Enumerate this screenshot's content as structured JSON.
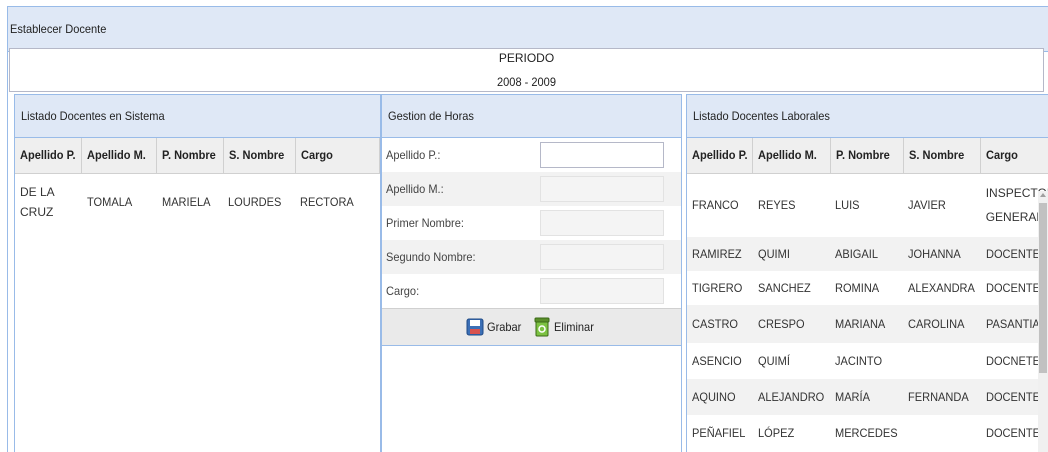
{
  "window": {
    "title": "Establecer Docente"
  },
  "periodo": {
    "label": "PERIODO",
    "value": "2008 - 2009"
  },
  "left_panel": {
    "title": "Listado Docentes en Sistema",
    "columns": [
      "Apellido P.",
      "Apellido M.",
      "P. Nombre",
      "S. Nombre",
      "Cargo"
    ],
    "rows": [
      {
        "ap": "DE LA\nCRUZ",
        "am": "TOMALA",
        "pn": "MARIELA",
        "sn": "LOURDES",
        "cargo": "RECTORA"
      }
    ]
  },
  "middle_panel": {
    "title": "Gestion de Horas",
    "fields": [
      {
        "label": "Apellido P.:",
        "value": ""
      },
      {
        "label": "Apellido M.:",
        "value": ""
      },
      {
        "label": "Primer Nombre:",
        "value": ""
      },
      {
        "label": "Segundo Nombre:",
        "value": ""
      },
      {
        "label": "Cargo:",
        "value": ""
      }
    ],
    "buttons": {
      "save": "Grabar",
      "delete": "Eliminar"
    }
  },
  "right_panel": {
    "title": "Listado Docentes Laborales",
    "columns": [
      "Apellido P.",
      "Apellido M.",
      "P. Nombre",
      "S. Nombre",
      "Cargo"
    ],
    "rows": [
      {
        "ap": "FRANCO",
        "am": "REYES",
        "pn": "LUIS",
        "sn": "JAVIER",
        "cargo": "INSPECTOR\nGENERAL"
      },
      {
        "ap": "RAMIREZ",
        "am": "QUIMI",
        "pn": "ABIGAIL",
        "sn": "JOHANNA",
        "cargo": "DOCENTE"
      },
      {
        "ap": "TIGRERO",
        "am": "SANCHEZ",
        "pn": "ROMINA",
        "sn": "ALEXANDRA",
        "cargo": "DOCENTE"
      },
      {
        "ap": "CASTRO",
        "am": "CRESPO",
        "pn": "MARIANA",
        "sn": "CAROLINA",
        "cargo": "PASANTIAS"
      },
      {
        "ap": "ASENCIO",
        "am": "QUIMÍ",
        "pn": "JACINTO",
        "sn": "",
        "cargo": "DOCNETE"
      },
      {
        "ap": "AQUINO",
        "am": "ALEJANDRO",
        "pn": "MARÍA",
        "sn": "FERNANDA",
        "cargo": "DOCENTE"
      },
      {
        "ap": "PEÑAFIEL",
        "am": "LÓPEZ",
        "pn": "MERCEDES",
        "sn": "",
        "cargo": "DOCENTE"
      }
    ]
  },
  "colors": {
    "header_bg": "#dfe8f6",
    "border": "#99bbe8",
    "row_alt": "#f2f2f2"
  },
  "icons": {
    "save": "floppy-disk-icon",
    "delete": "recycle-bin-icon"
  }
}
